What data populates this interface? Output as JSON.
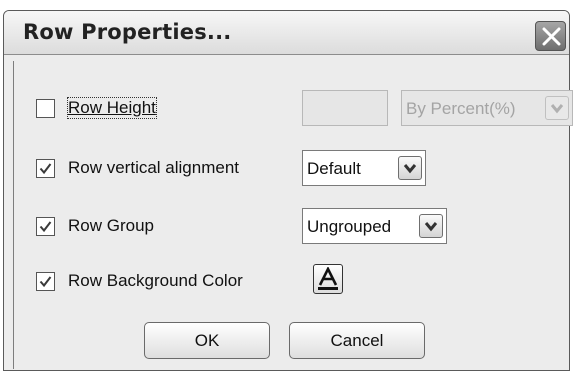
{
  "dialog": {
    "title": "Row Properties...",
    "close_icon": "close-x-icon"
  },
  "rows": {
    "row_height": {
      "label": "Row Height",
      "checked": false,
      "value": "",
      "unit_selected": "By Percent(%)",
      "disabled": true
    },
    "vertical_alignment": {
      "label": "Row vertical alignment",
      "checked": true,
      "selected": "Default"
    },
    "row_group": {
      "label": "Row Group",
      "checked": true,
      "selected": "Ungrouped"
    },
    "background_color": {
      "label": "Row Background Color",
      "checked": true,
      "icon": "text-color-icon"
    }
  },
  "buttons": {
    "ok": "OK",
    "cancel": "Cancel"
  },
  "colors": {
    "check_mark": "#3a3a3a",
    "disabled_text": "#a4a4a4"
  }
}
